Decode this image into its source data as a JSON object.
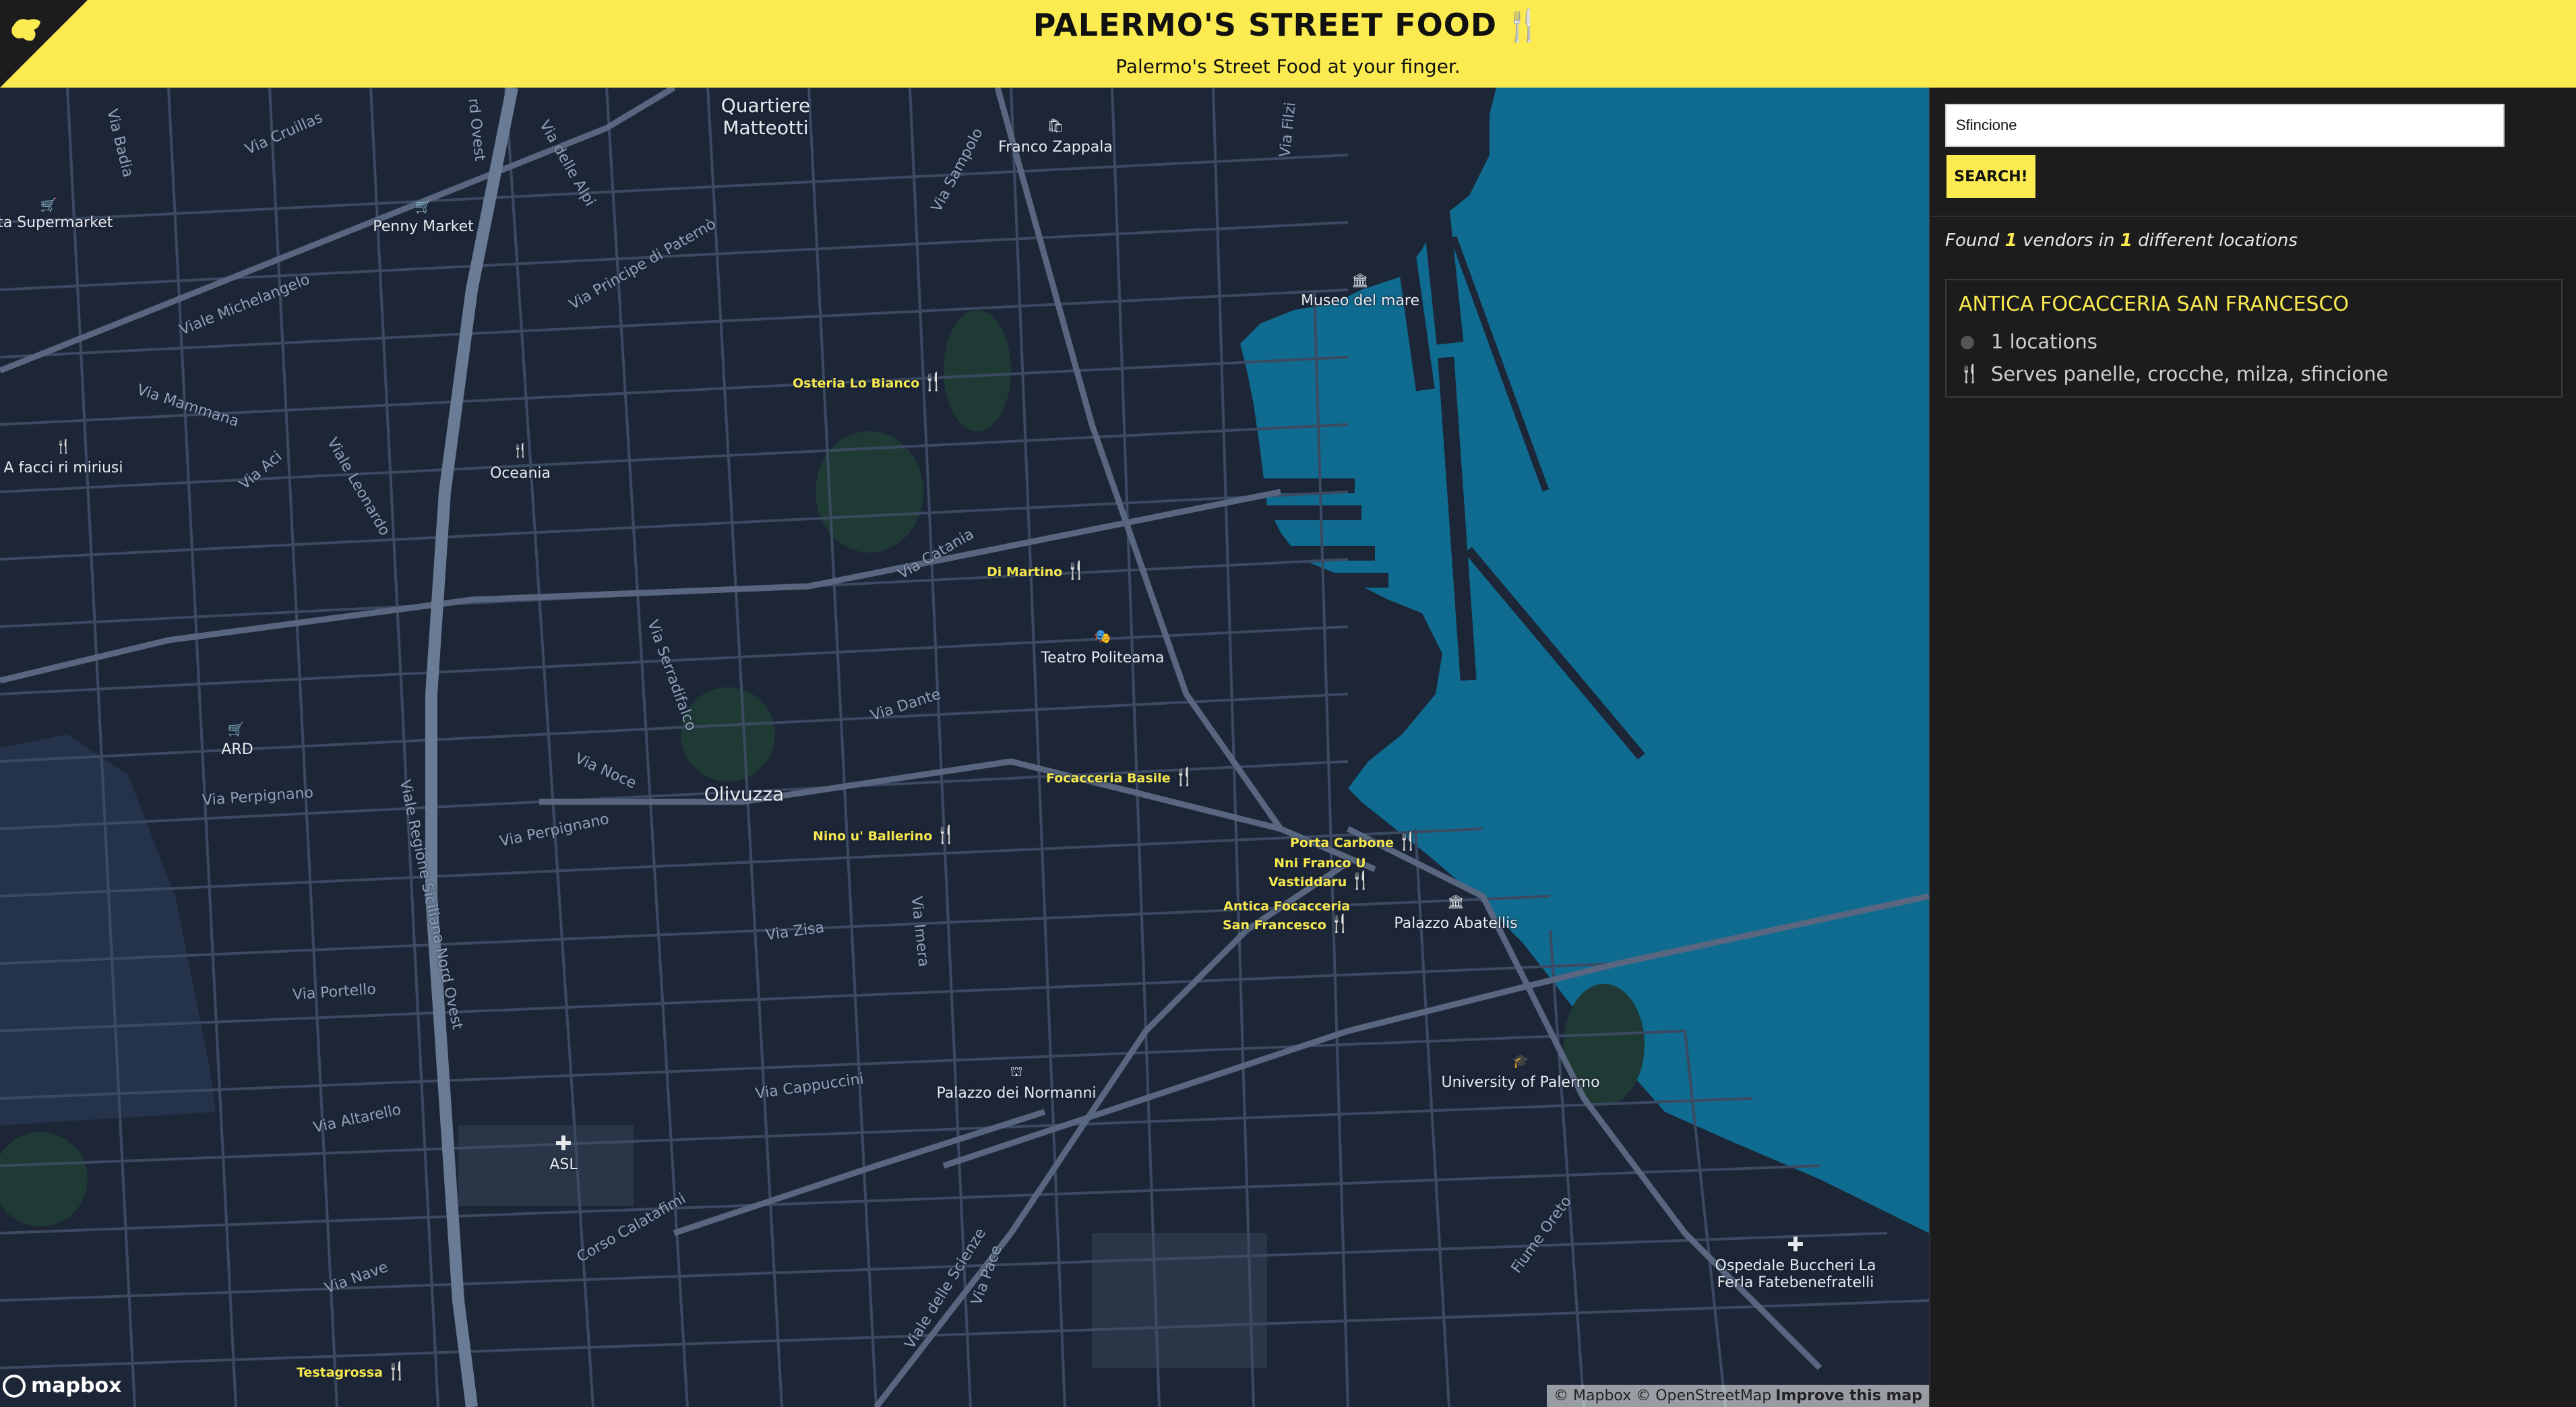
{
  "header": {
    "title": "PALERMO'S STREET FOOD",
    "title_icon": "🍴🍴",
    "subtitle": "Palermo's Street Food at your finger."
  },
  "colors": {
    "accent": "#fbeb50",
    "map_land": "#1c2637",
    "map_sea": "#0f6b90",
    "road": "#4d5d75",
    "vendor_label": "#f5e84f"
  },
  "map": {
    "places": [
      {
        "id": "quartiere",
        "text": "Quartiere\nMatteotti"
      },
      {
        "id": "franco",
        "text": "Franco Zappala"
      },
      {
        "id": "supermarket",
        "text": "sta Supermarket"
      },
      {
        "id": "penny",
        "text": "Penny Market"
      },
      {
        "id": "museo",
        "text": "Museo del mare"
      },
      {
        "id": "afacci",
        "text": "A facci ri miriusi"
      },
      {
        "id": "oceania",
        "text": "Oceania"
      },
      {
        "id": "teatro",
        "text": "Teatro Politeama"
      },
      {
        "id": "ard",
        "text": "ARD"
      },
      {
        "id": "olivuzza",
        "text": "Olivuzza"
      },
      {
        "id": "abatellis",
        "text": "Palazzo Abatellis"
      },
      {
        "id": "normanni",
        "text": "Palazzo dei Normanni"
      },
      {
        "id": "university",
        "text": "University of Palermo"
      },
      {
        "id": "asl",
        "text": "ASL"
      },
      {
        "id": "ospedale",
        "text": "Ospedale Buccheri La\nFerla Fatebenefratelli"
      }
    ],
    "streets": [
      {
        "id": "cruillas",
        "text": "Via Cruillas"
      },
      {
        "id": "michelangelo",
        "text": "Viale Michelangelo"
      },
      {
        "id": "principe",
        "text": "Via Principe di Paternò"
      },
      {
        "id": "mammana",
        "text": "Via Mammana"
      },
      {
        "id": "aci",
        "text": "Via Aci"
      },
      {
        "id": "leonardo",
        "text": "Viale Leonardo"
      },
      {
        "id": "catania",
        "text": "Via Catania"
      },
      {
        "id": "dante",
        "text": "Via Dante"
      },
      {
        "id": "noce",
        "text": "Via Noce"
      },
      {
        "id": "perpignano1",
        "text": "Via Perpignano"
      },
      {
        "id": "perpignano2",
        "text": "Via Perpignano"
      },
      {
        "id": "regione",
        "text": "Viale Regione Siciliana Nord Ovest"
      },
      {
        "id": "zisa",
        "text": "Via Zisa"
      },
      {
        "id": "portello",
        "text": "Via Portello"
      },
      {
        "id": "cappuccini",
        "text": "Via Cappuccini"
      },
      {
        "id": "altarello",
        "text": "Via Altarello"
      },
      {
        "id": "calatafimi",
        "text": "Corso Calatafimi"
      },
      {
        "id": "nave",
        "text": "Via Nave"
      },
      {
        "id": "scienze",
        "text": "Viale delle Scienze"
      },
      {
        "id": "oreto",
        "text": "Fiume Oreto"
      },
      {
        "id": "sampolo",
        "text": "Via Sampolo"
      },
      {
        "id": "finocchiaro",
        "text": "Via Serradifalco"
      },
      {
        "id": "imera",
        "text": "Via Imera"
      },
      {
        "id": "pace",
        "text": "Via Pace"
      },
      {
        "id": "filzi",
        "text": "Via Filzi"
      },
      {
        "id": "badia",
        "text": "Via Badia"
      },
      {
        "id": "alpi",
        "text": "Via delle Alpi"
      },
      {
        "id": "ovest",
        "text": "rd Ovest"
      }
    ],
    "vendors": [
      {
        "id": "osteria",
        "text": "Osteria Lo Bianco"
      },
      {
        "id": "dimartino",
        "text": "Di Martino"
      },
      {
        "id": "basile",
        "text": "Focacceria Basile"
      },
      {
        "id": "ballerino",
        "text": "Nino u' Ballerino"
      },
      {
        "id": "carbone",
        "text": "Porta Carbone"
      },
      {
        "id": "vastiddaru",
        "text": "Nni Franco U\nVastiddaru"
      },
      {
        "id": "antica",
        "text": "Antica Focacceria\nSan Francesco"
      },
      {
        "id": "testagrossa",
        "text": "Testagrossa"
      }
    ],
    "logo": "mapbox",
    "attribution": "© Mapbox © OpenStreetMap",
    "improve": "Improve this map"
  },
  "search": {
    "value": "Sfincione",
    "button": "SEARCH!"
  },
  "results": {
    "found_prefix": "Found",
    "vendors_count": "1",
    "vendors_mid": "vendors in",
    "locations_count": "1",
    "locations_suffix": "different locations",
    "items": [
      {
        "name": "ANTICA FOCACCERIA SAN FRANCESCO",
        "locations": "1 locations",
        "serves": "Serves panelle, crocche, milza, sfincione"
      }
    ]
  }
}
